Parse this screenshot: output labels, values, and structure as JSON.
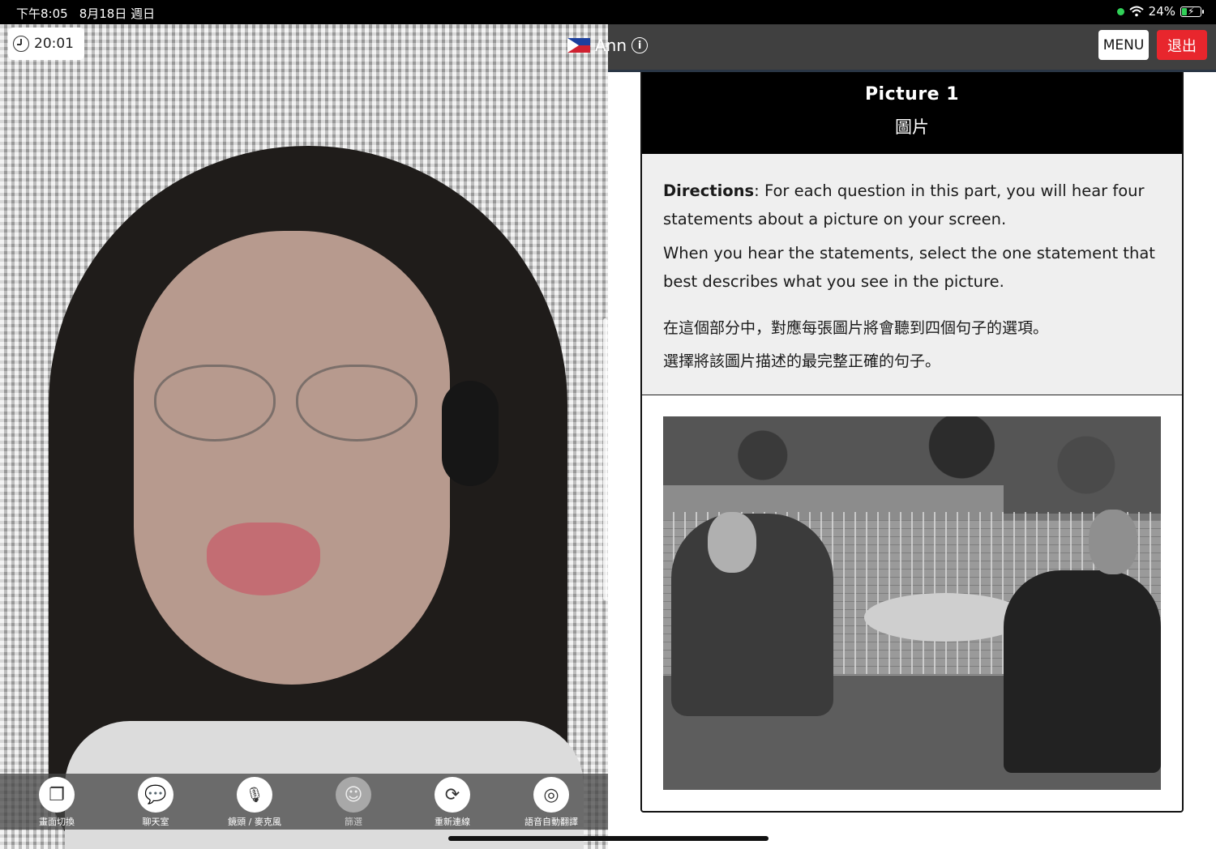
{
  "status_bar": {
    "time": "下午8:05",
    "date": "8月18日 週日",
    "battery": "24%"
  },
  "session": {
    "timer": "20:01",
    "teacher_name": "Ann"
  },
  "header": {
    "menu_label": "MENU",
    "exit_label": "退出"
  },
  "toolbar": {
    "items": [
      {
        "label": "畫面切換",
        "icon": "switch-screen-icon",
        "enabled": true
      },
      {
        "label": "聊天室",
        "icon": "chat-icon",
        "enabled": true
      },
      {
        "label": "鏡頭 / 麥克風",
        "icon": "camera-mic-icon",
        "enabled": true
      },
      {
        "label": "篩選",
        "icon": "filter-icon",
        "enabled": false
      },
      {
        "label": "重新連線",
        "icon": "reconnect-icon",
        "enabled": true
      },
      {
        "label": "語音自動翻譯",
        "icon": "globe-icon",
        "enabled": true
      }
    ]
  },
  "question": {
    "title": "Picture 1",
    "subtitle": "圖片",
    "directions_label": "Directions",
    "directions_text_1": ": For each question in this part, you will hear four statements about a picture on your screen.",
    "directions_text_2": "When you hear the statements, select the one statement that best describes what you see in the picture.",
    "directions_zh_1": "在這個部分中，對應每張圖片將會聽到四個句子的選項。",
    "directions_zh_2": "選擇將該圖片描述的最完整正確的句子。"
  },
  "colors": {
    "exit_button": "#e8262d",
    "topbar": "#404040",
    "wifi_dot": "#31d158"
  }
}
